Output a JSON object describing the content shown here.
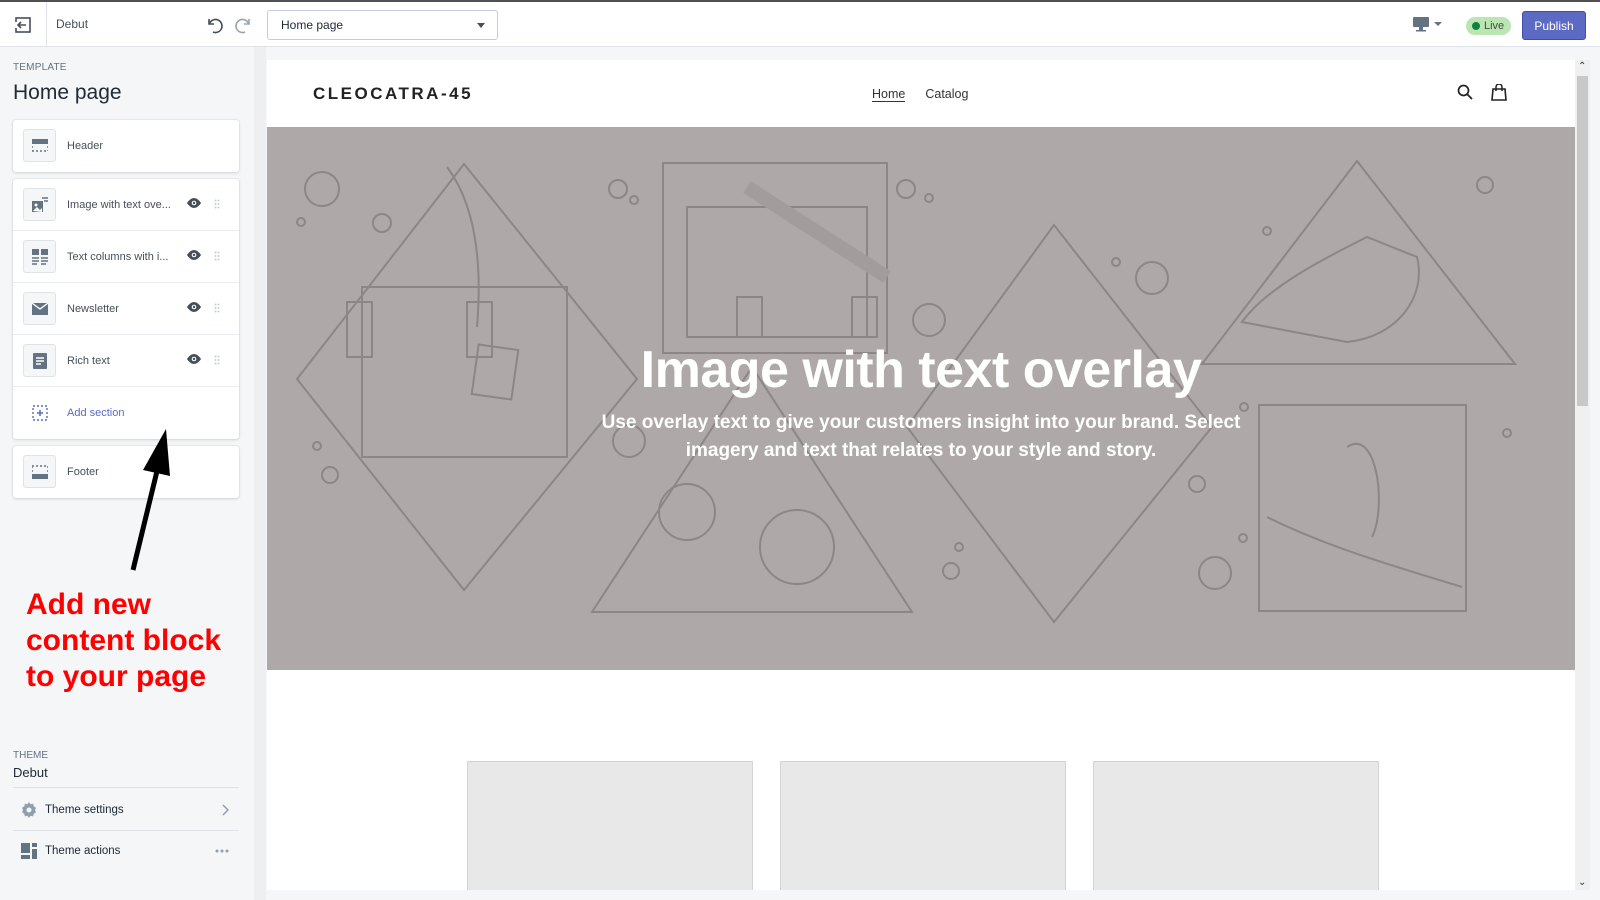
{
  "topbar": {
    "theme_name": "Debut",
    "page_select": "Home page",
    "live_badge": "Live",
    "publish_label": "Publish"
  },
  "sidebar": {
    "template_label": "TEMPLATE",
    "template_title": "Home page",
    "header_section": {
      "label": "Header",
      "icon": "header-layout-icon"
    },
    "sections": [
      {
        "label": "Image with text ove...",
        "icon": "image-text-icon"
      },
      {
        "label": "Text columns with i...",
        "icon": "text-columns-icon"
      },
      {
        "label": "Newsletter",
        "icon": "envelope-icon"
      },
      {
        "label": "Rich text",
        "icon": "rich-text-icon"
      }
    ],
    "add_section_label": "Add section",
    "footer_section": {
      "label": "Footer",
      "icon": "footer-layout-icon"
    },
    "theme_label": "THEME",
    "theme_name": "Debut",
    "theme_settings_label": "Theme settings",
    "theme_actions_label": "Theme actions"
  },
  "annotation": {
    "line1": "Add new",
    "line2": "content block",
    "line3": "to your page",
    "color": "#ff0000"
  },
  "preview": {
    "store_logo": "CLEOCATRA-45",
    "nav": [
      "Home",
      "Catalog"
    ],
    "hero_title": "Image with text overlay",
    "hero_subtitle": "Use overlay text to give your customers insight into your brand. Select imagery and text that relates to your style and story."
  },
  "colors": {
    "accent": "#5c6ac4",
    "live_bg": "#bbe5b3",
    "live_dot": "#108043",
    "hero_bg": "#afa8a8"
  }
}
